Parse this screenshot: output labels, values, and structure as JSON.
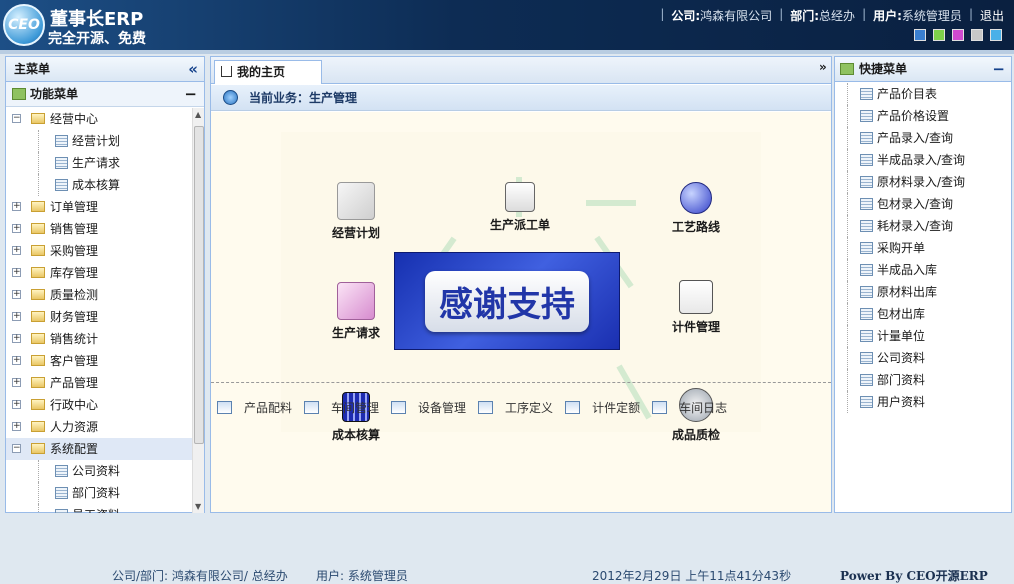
{
  "header": {
    "logo_text": "CEO",
    "app_name": "董事长ERP",
    "slogan": "完全开源、免费",
    "company_label": "公司:",
    "company_value": "鸿森有限公司",
    "dept_label": "部门:",
    "dept_value": "总经办",
    "user_label": "用户:",
    "user_value": "系统管理员",
    "logout": "退出",
    "theme_colors": [
      "#3a7fd0",
      "#7ed04a",
      "#d04ad0",
      "#c8c8c8",
      "#4ab0e8"
    ]
  },
  "left_panel": {
    "title": "主菜单",
    "collapse_icon": "«",
    "section_title": "功能菜单",
    "section_ctl": "−",
    "tree": [
      {
        "label": "经营中心",
        "expanded": true,
        "children": [
          "经营计划",
          "生产请求",
          "成本核算"
        ]
      },
      {
        "label": "订单管理"
      },
      {
        "label": "销售管理"
      },
      {
        "label": "采购管理"
      },
      {
        "label": "库存管理"
      },
      {
        "label": "质量检测"
      },
      {
        "label": "财务管理"
      },
      {
        "label": "销售统计"
      },
      {
        "label": "客户管理"
      },
      {
        "label": "产品管理"
      },
      {
        "label": "行政中心"
      },
      {
        "label": "人力资源"
      },
      {
        "label": "系统配置",
        "expanded": true,
        "selected": true,
        "children": [
          "公司资料",
          "部门资料",
          "员工资料"
        ]
      }
    ]
  },
  "center": {
    "tab_label": "我的主页",
    "tab_scroll": "»",
    "biz_label": "当前业务：生产管理",
    "flow_nodes": {
      "plan": "经营计划",
      "dispatch": "生产派工单",
      "route": "工艺路线",
      "request": "生产请求",
      "piece": "计件管理",
      "cost": "成本核算",
      "qc": "成品质检"
    },
    "thanks_text": "感谢支持",
    "mgmt_items": [
      "产品配料",
      "车间管理",
      "设备管理",
      "工序定义",
      "计件定额",
      "车间日志"
    ]
  },
  "right_panel": {
    "title": "快捷菜单",
    "ctl": "−",
    "items": [
      "产品价目表",
      "产品价格设置",
      "产品录入/查询",
      "半成品录入/查询",
      "原材料录入/查询",
      "包材录入/查询",
      "耗材录入/查询",
      "采购开单",
      "半成品入库",
      "原材料出库",
      "包材出库",
      "计量单位",
      "公司资料",
      "部门资料",
      "用户资料"
    ]
  },
  "status": {
    "company_dept": "公司/部门:  鸿森有限公司/ 总经办",
    "user": "用户:  系统管理员",
    "datetime": "2012年2月29日 上午11点41分43秒",
    "powered": "Power By CEO开源ERP"
  }
}
